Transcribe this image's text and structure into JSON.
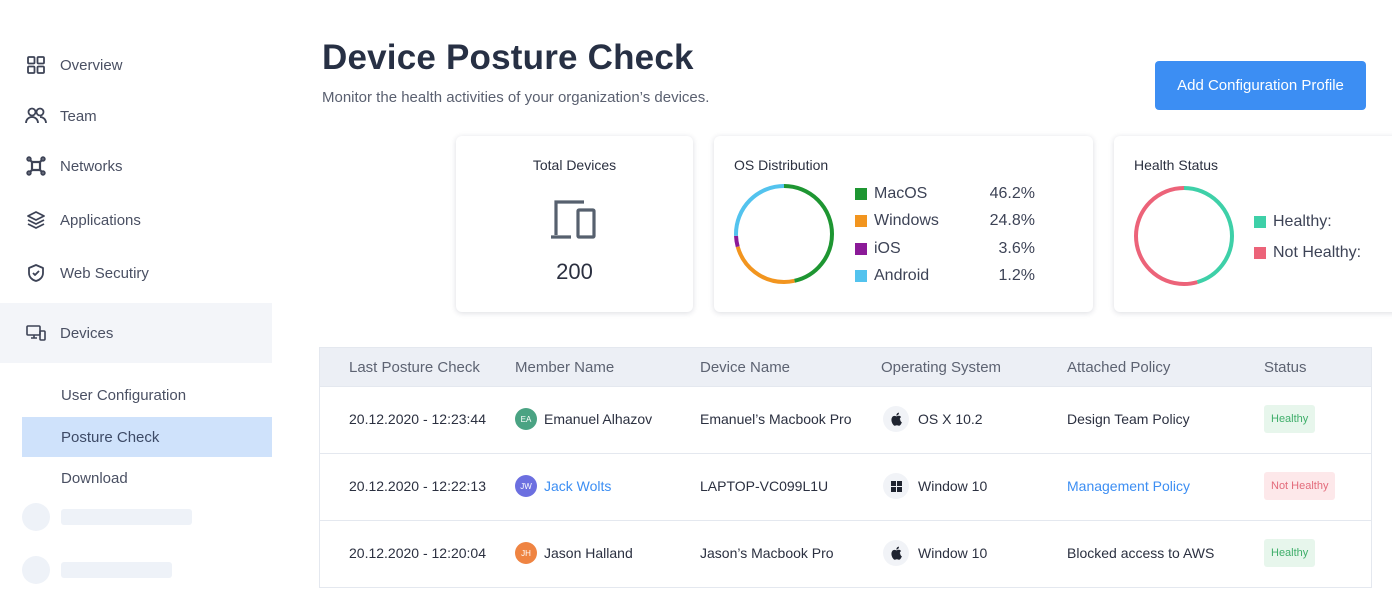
{
  "sidebar": {
    "items": [
      {
        "label": "Overview",
        "icon": "grid-icon"
      },
      {
        "label": "Team",
        "icon": "users-icon"
      },
      {
        "label": "Networks",
        "icon": "network-icon"
      },
      {
        "label": "Applications",
        "icon": "layers-icon"
      },
      {
        "label": "Web Secutiry",
        "icon": "shield-icon"
      },
      {
        "label": "Devices",
        "icon": "devices-icon"
      }
    ],
    "sub_items": [
      {
        "label": "User Configuration"
      },
      {
        "label": "Posture Check"
      },
      {
        "label": "Download"
      }
    ]
  },
  "header": {
    "title": "Device Posture Check",
    "subtitle": "Monitor the health activities of your organization’s devices.",
    "add_button": "Add Configuration Profile"
  },
  "cards": {
    "total": {
      "title": "Total Devices",
      "value": "200"
    },
    "os": {
      "title": "OS Distribution",
      "items": [
        {
          "label": "MacOS",
          "value": "46.2%",
          "pct": 46.2,
          "color": "#1e9632"
        },
        {
          "label": "Windows",
          "value": "24.8%",
          "pct": 24.8,
          "color": "#f2951f"
        },
        {
          "label": "iOS",
          "value": "3.6%",
          "pct": 3.6,
          "color": "#8b1a98"
        },
        {
          "label": "Android",
          "value": "1.2%",
          "pct": 1.2,
          "color": "#53c3ee"
        }
      ]
    },
    "health": {
      "title": "Health Status",
      "items": [
        {
          "label": "Healthy:",
          "color": "#3ed0a8"
        },
        {
          "label": "Not Healthy:",
          "color": "#ec6379"
        }
      ]
    }
  },
  "table": {
    "headers": [
      "Last Posture Check",
      "Member Name",
      "Device Name",
      "Operating System",
      "Attached Policy",
      "Status"
    ],
    "rows": [
      {
        "date": "20.12.2020 - 12:23:44",
        "initials": "EA",
        "avatar_color": "#4aa383",
        "member": "Emanuel Alhazov",
        "member_link": false,
        "device": "Emanuel’s Macbook Pro",
        "os_icon": "apple-icon",
        "os": "OS X 10.2",
        "policy": "Design Team Policy",
        "policy_link": false,
        "status": "Healthy",
        "status_kind": "ok"
      },
      {
        "date": "20.12.2020 - 12:22:13",
        "initials": "JW",
        "avatar_color": "#6c6fe0",
        "member": "Jack Wolts",
        "member_link": true,
        "device": "LAPTOP-VC099L1U",
        "os_icon": "windows-icon",
        "os": "Window 10",
        "policy": "Management Policy",
        "policy_link": true,
        "status": "Not Healthy",
        "status_kind": "bad"
      },
      {
        "date": "20.12.2020 - 12:20:04",
        "initials": "JH",
        "avatar_color": "#ef8442",
        "member": "Jason Halland",
        "member_link": false,
        "device": "Jason’s Macbook Pro",
        "os_icon": "apple-icon",
        "os": "Window 10",
        "policy": "Blocked access to AWS",
        "policy_link": false,
        "status": "Healthy",
        "status_kind": "ok"
      }
    ]
  }
}
